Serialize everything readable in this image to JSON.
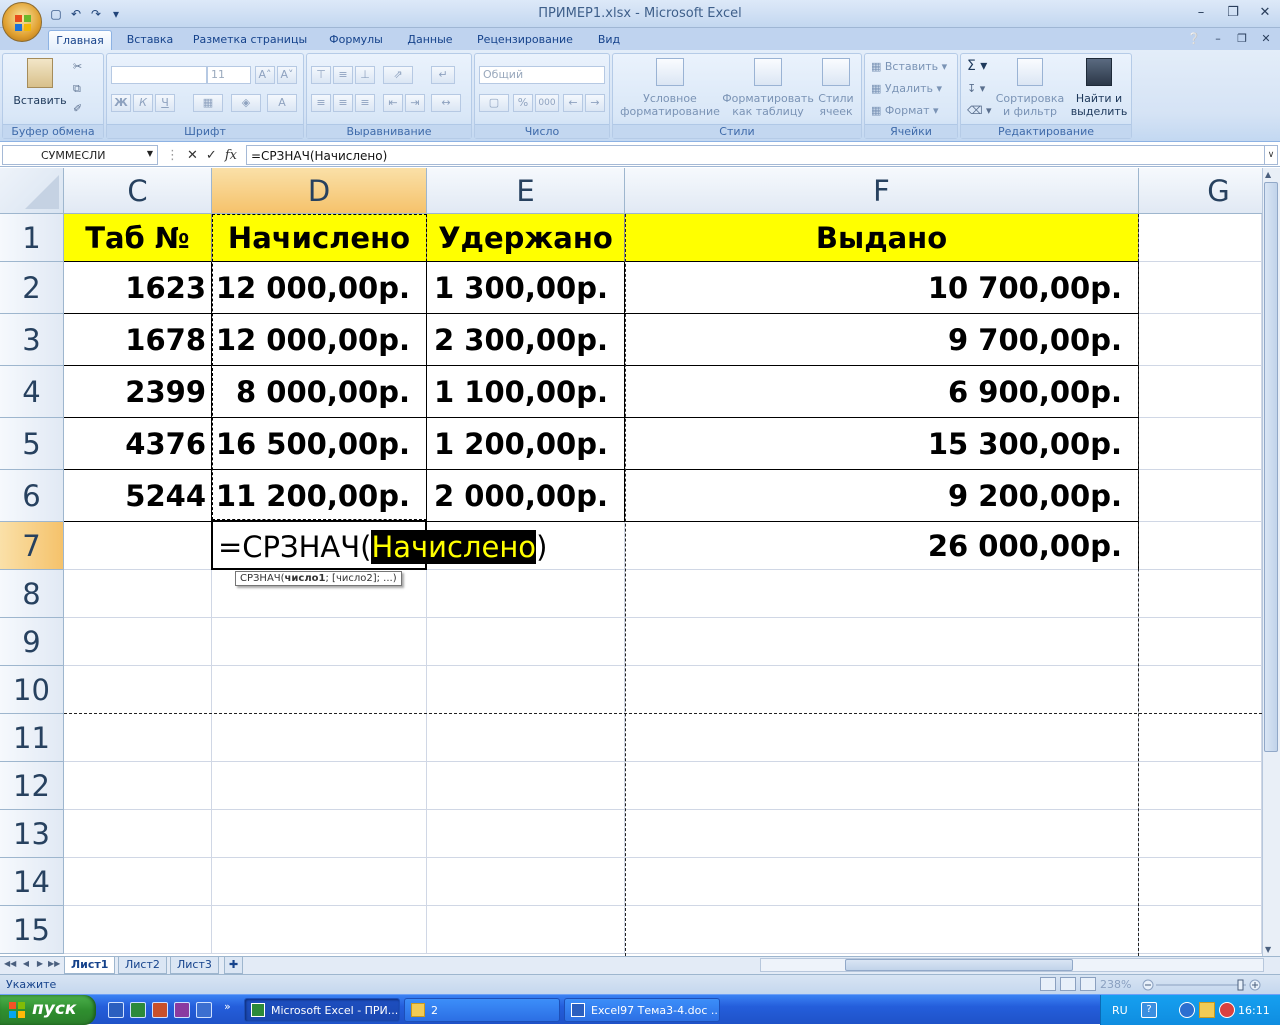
{
  "window": {
    "title": "ПРИМЕР1.xlsx - Microsoft Excel"
  },
  "tabs": [
    "Главная",
    "Вставка",
    "Разметка страницы",
    "Формулы",
    "Данные",
    "Рецензирование",
    "Вид"
  ],
  "ribbon": {
    "clipboard": {
      "label": "Буфер обмена",
      "paste": "Вставить"
    },
    "font": {
      "label": "Шрифт",
      "size": "11",
      "bold": "Ж",
      "italic": "К",
      "underline": "Ч"
    },
    "alignment": {
      "label": "Выравнивание"
    },
    "number": {
      "label": "Число",
      "format": "Общий"
    },
    "styles": {
      "label": "Стили",
      "cond_format": "Условное\nформатирование",
      "format_table": "Форматировать\nкак таблицу",
      "cell_styles": "Стили\nячеек"
    },
    "cells": {
      "label": "Ячейки",
      "insert": "Вставить",
      "delete": "Удалить",
      "format": "Формат"
    },
    "editing": {
      "label": "Редактирование",
      "sort_filter": "Сортировка\nи фильтр",
      "find_select": "Найти и\nвыделить"
    }
  },
  "formula_bar": {
    "name_box": "СУММЕСЛИ",
    "formula": "=СРЗНАЧ(Начислено)"
  },
  "columns": [
    "C",
    "D",
    "E",
    "F",
    "G"
  ],
  "selected_column": "D",
  "rows": [
    "1",
    "2",
    "3",
    "4",
    "5",
    "6",
    "7",
    "8",
    "9",
    "10",
    "11",
    "12",
    "13",
    "14",
    "15"
  ],
  "selected_row": "7",
  "table": {
    "headers": [
      "Таб №",
      "Начислено",
      "Удержано",
      "Выдано"
    ],
    "rows": [
      [
        "1623",
        "12 000,00р.",
        "1 300,00р.",
        "10 700,00р."
      ],
      [
        "1678",
        "12 000,00р.",
        "2 300,00р.",
        "9 700,00р."
      ],
      [
        "2399",
        "8 000,00р.",
        "1 100,00р.",
        "6 900,00р."
      ],
      [
        "4376",
        "16 500,00р.",
        "1 200,00р.",
        "15 300,00р."
      ],
      [
        "5244",
        "11 200,00р.",
        "2 000,00р.",
        "9 200,00р."
      ]
    ],
    "row7_f": "26 000,00р."
  },
  "edit": {
    "prefix": "=СРЗНАЧ(",
    "highlight": "Начислено",
    "suffix": ")"
  },
  "tooltip": {
    "fn": "СРЗНАЧ(",
    "arg1": "число1",
    "rest": "; [число2]; ...)"
  },
  "sheets": [
    "Лист1",
    "Лист2",
    "Лист3"
  ],
  "status": {
    "mode": "Укажите",
    "zoom": "238%"
  },
  "taskbar": {
    "start": "пуск",
    "tasks": [
      "Microsoft Excel - ПРИ...",
      "2",
      "Excel97 Тема3-4.doc ..."
    ],
    "lang": "RU",
    "clock": "16:11"
  }
}
